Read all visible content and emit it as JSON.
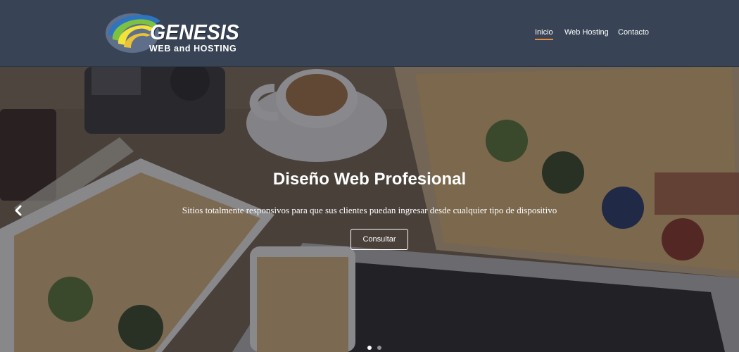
{
  "logo": {
    "word": "GENESIS",
    "sub": "WEB and HOSTING",
    "icon": "genesis-swoosh-logo"
  },
  "nav": {
    "items": [
      {
        "label": "Inicio",
        "active": true
      },
      {
        "label": "Web Hosting",
        "active": false
      },
      {
        "label": "Contacto",
        "active": false
      }
    ],
    "active_color": "#e98a3b"
  },
  "hero": {
    "title": "Diseño Web Profesional",
    "subtitle": "Sitios totalmente responsivos para que sus clientes puedan ingresar desde cualquier tipo de dispositivo",
    "button_label": "Consultar",
    "prev_icon": "chevron-left-icon"
  },
  "colors": {
    "header_bg": "#384455",
    "accent": "#e98a3b"
  }
}
